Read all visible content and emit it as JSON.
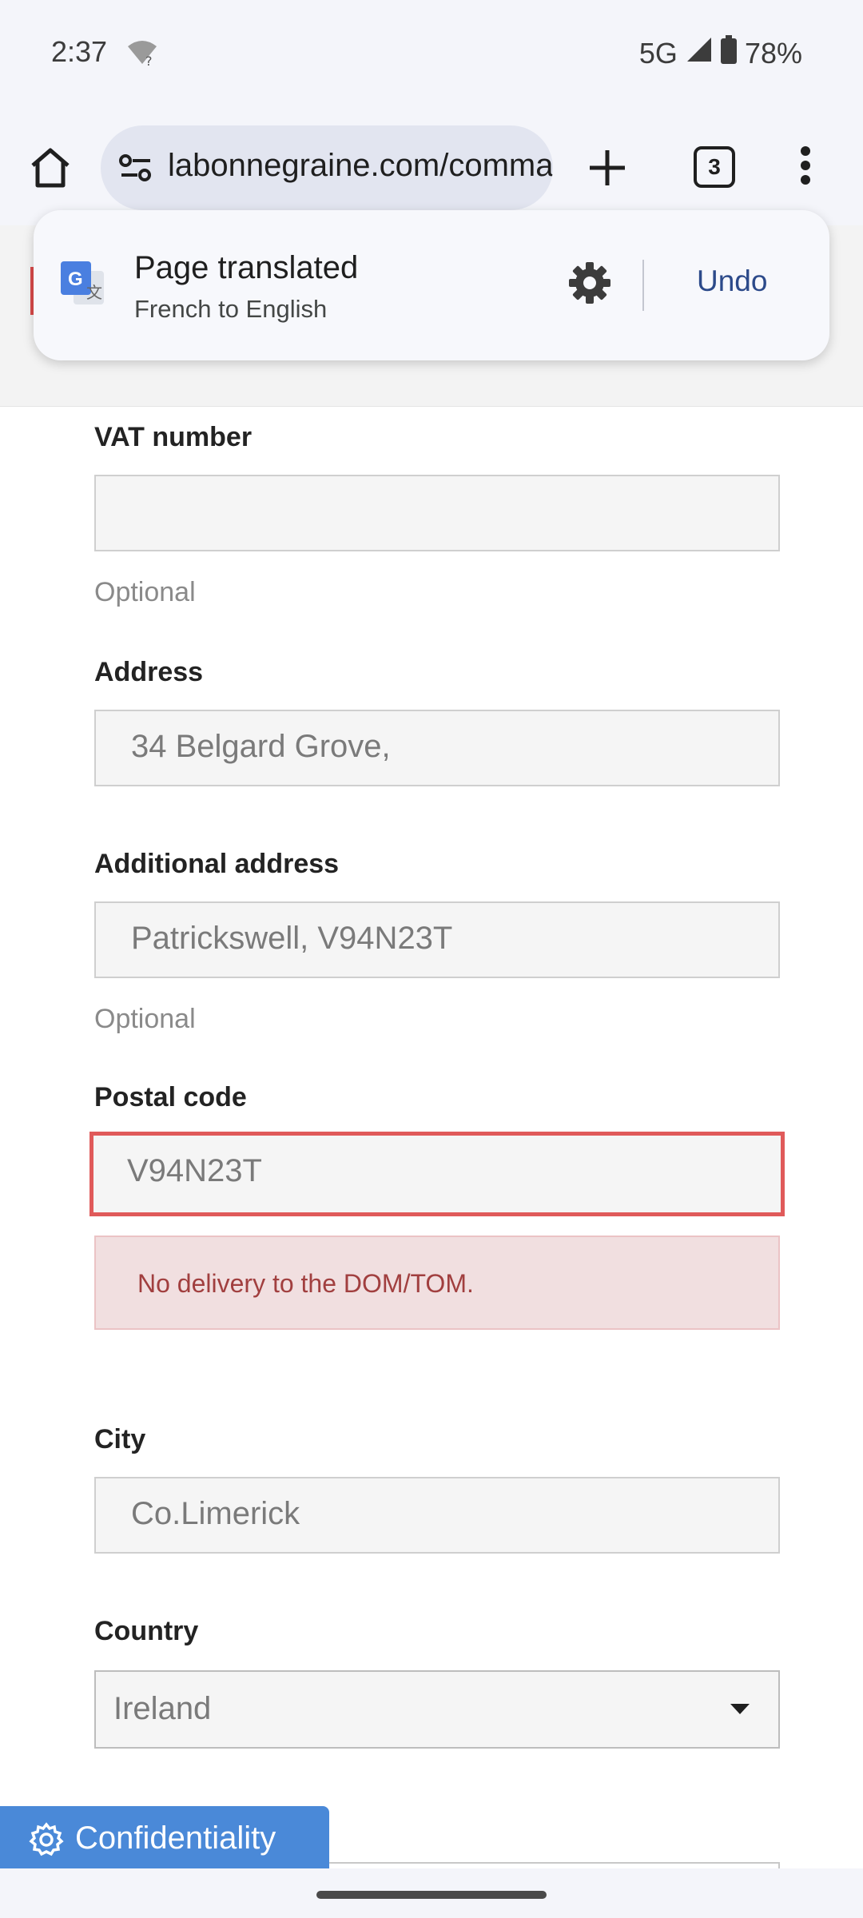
{
  "status_bar": {
    "time": "2:37",
    "network": "5G",
    "battery": "78%"
  },
  "browser": {
    "url": "labonnegraine.com/commande",
    "tab_count": "3"
  },
  "translate_popup": {
    "title": "Page translated",
    "subtitle": "French to English",
    "undo_label": "Undo"
  },
  "form": {
    "vat": {
      "label": "VAT number",
      "value": "",
      "hint": "Optional"
    },
    "address": {
      "label": "Address",
      "value": "34 Belgard Grove,"
    },
    "additional_address": {
      "label": "Additional address",
      "value": "Patrickswell, V94N23T",
      "hint": "Optional"
    },
    "postal_code": {
      "label": "Postal code",
      "value": "V94N23T",
      "error": "No delivery to the DOM/TOM."
    },
    "city": {
      "label": "City",
      "value": "Co.Limerick"
    },
    "country": {
      "label": "Country",
      "value": "Ireland"
    }
  },
  "confidentiality": {
    "label": "Confidentiality"
  },
  "colors": {
    "error_border": "#e05a5a",
    "error_bg": "#f1dfe0",
    "accent_blue": "#4a89d8",
    "undo_blue": "#2c4a8a"
  }
}
